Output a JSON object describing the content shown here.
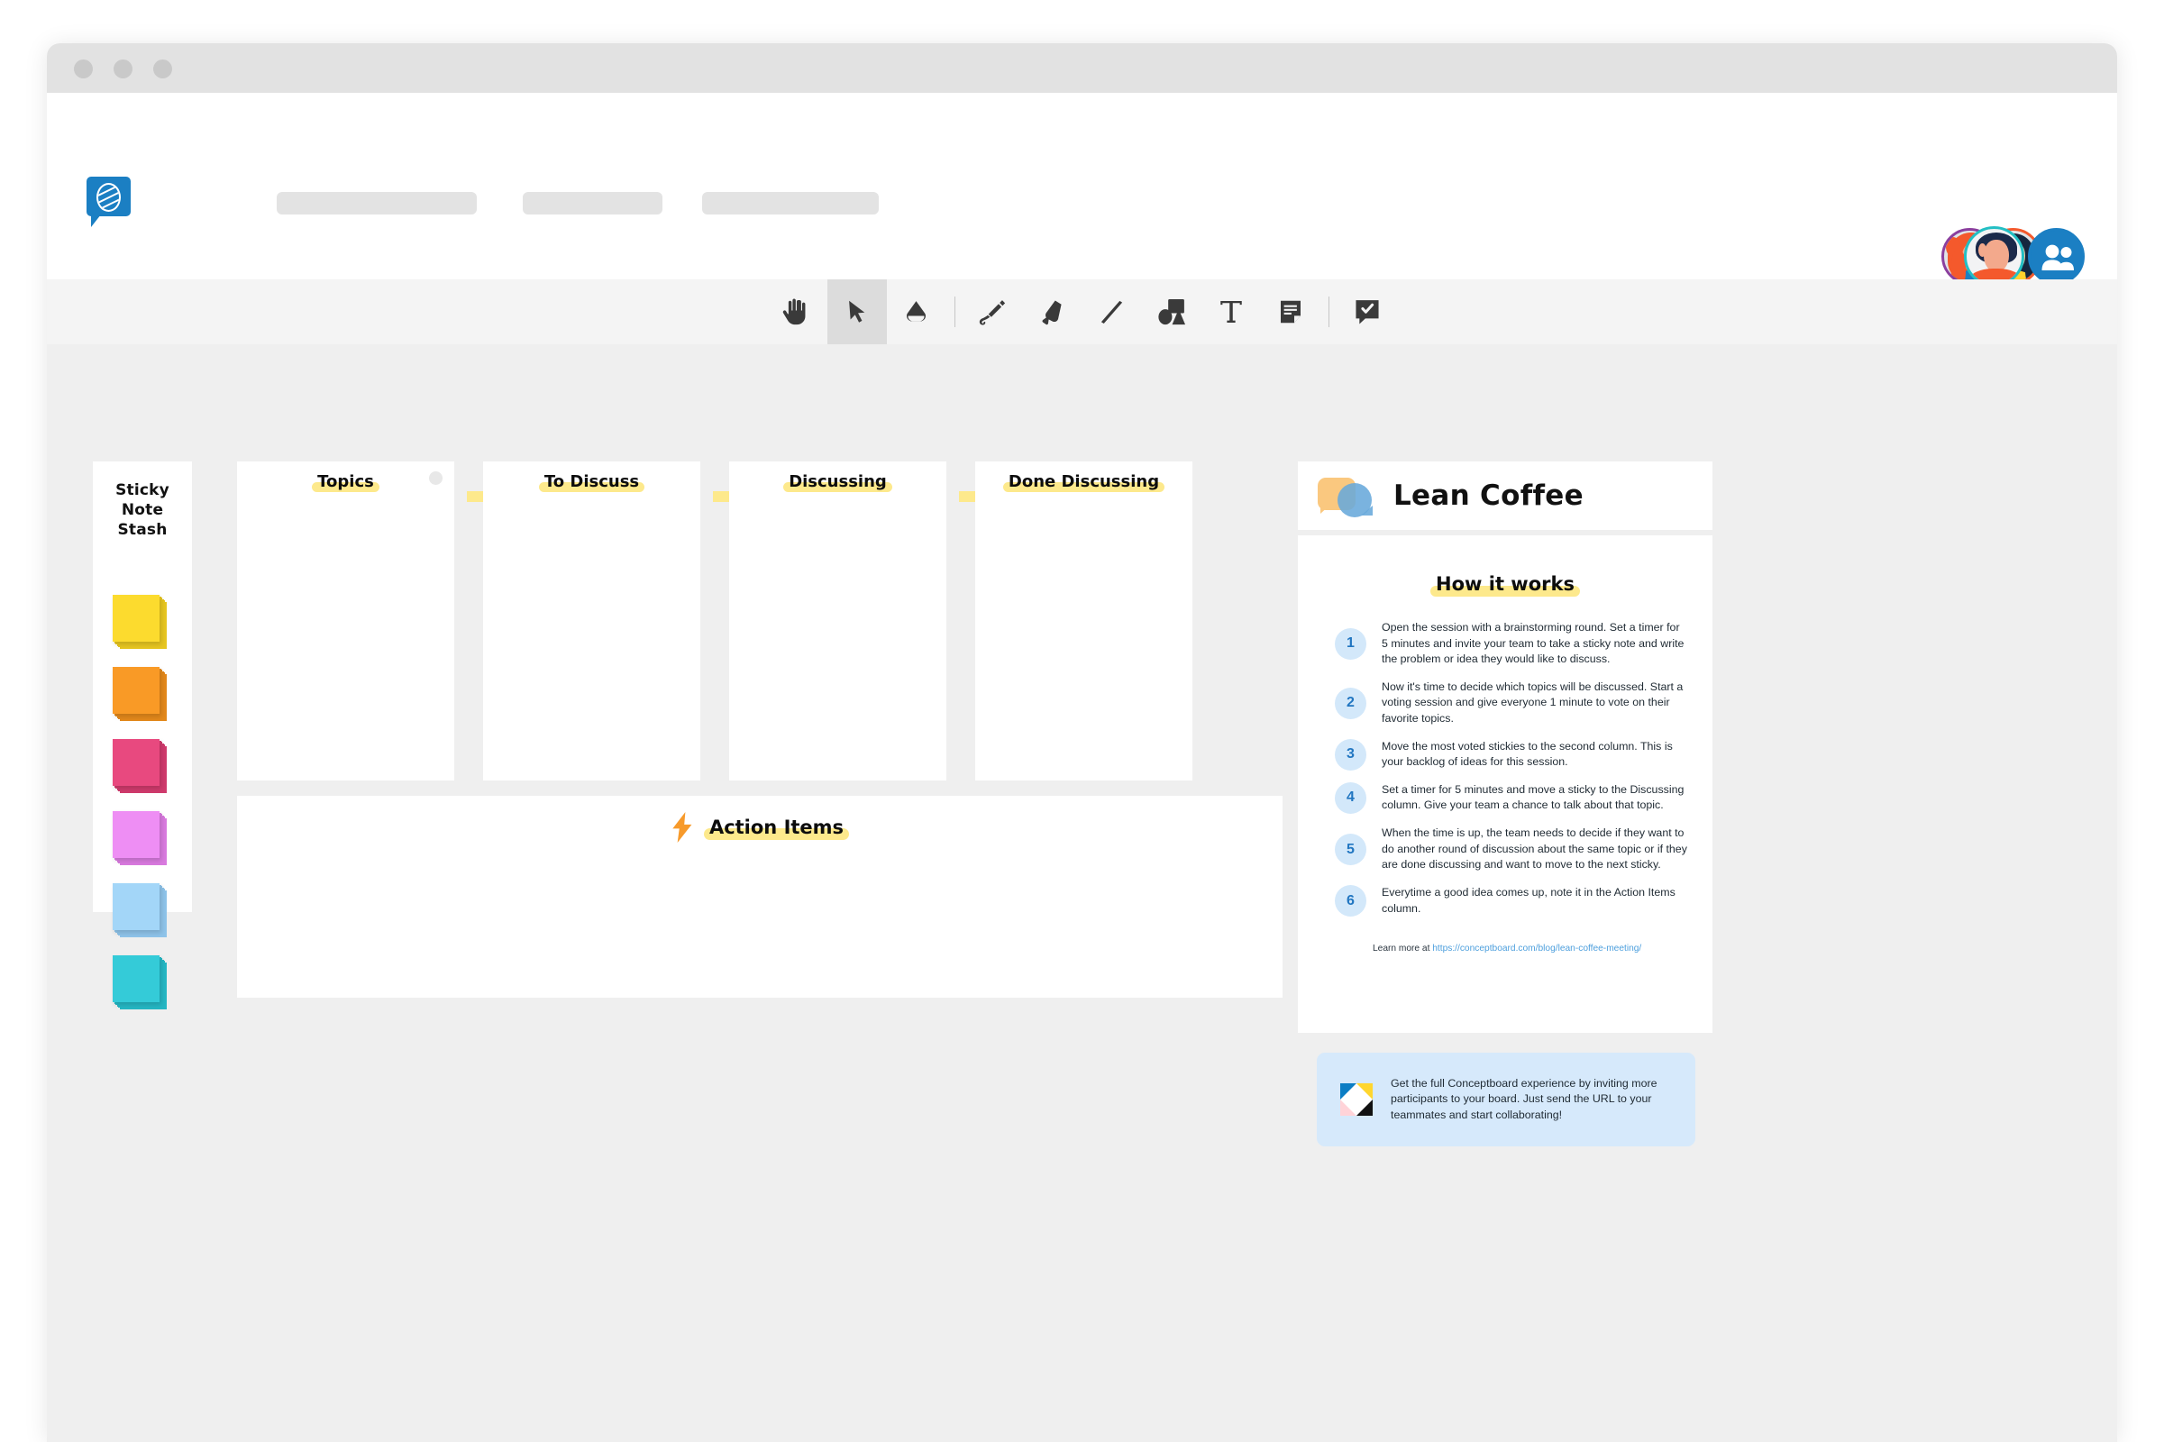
{
  "window": {
    "controls": [
      "close",
      "minimize",
      "maximize"
    ]
  },
  "header": {
    "logo_name": "conceptboard-logo",
    "nav_placeholders": [
      "",
      "",
      ""
    ],
    "avatars": [
      {
        "name": "collaborator-1",
        "ring": "#8b3f9e"
      },
      {
        "name": "collaborator-2",
        "ring": "#f4592c"
      },
      {
        "name": "invite-people",
        "ring": "#1b7fc3"
      }
    ],
    "self_avatar": {
      "name": "current-user",
      "ring": "#23bfc4"
    }
  },
  "toolbar": {
    "tools": [
      {
        "id": "hand",
        "label": "Pan",
        "active": false
      },
      {
        "id": "select",
        "label": "Select",
        "active": true
      },
      {
        "id": "eraser",
        "label": "Eraser",
        "active": false
      },
      {
        "id": "sep1",
        "label": "",
        "active": false
      },
      {
        "id": "pen",
        "label": "Pen",
        "active": false
      },
      {
        "id": "marker",
        "label": "Marker",
        "active": false
      },
      {
        "id": "line",
        "label": "Line",
        "active": false
      },
      {
        "id": "shapes",
        "label": "Shapes",
        "active": false
      },
      {
        "id": "text",
        "label": "Text",
        "active": false
      },
      {
        "id": "sticky-note",
        "label": "Sticky Note",
        "active": false
      },
      {
        "id": "sep2",
        "label": "",
        "active": false
      },
      {
        "id": "comment",
        "label": "Comment",
        "active": false
      }
    ]
  },
  "board": {
    "stash": {
      "title": "Sticky\nNote\nStash",
      "title_lines": [
        "Sticky",
        "Note",
        "Stash"
      ],
      "colors": [
        {
          "name": "yellow",
          "top": "#fcdb2e",
          "shade": "#e6c520"
        },
        {
          "name": "orange",
          "top": "#f99a26",
          "shade": "#e2881b"
        },
        {
          "name": "pink",
          "top": "#e8497f",
          "shade": "#cf3a6c"
        },
        {
          "name": "violet",
          "top": "#ee8ef4",
          "shade": "#d87ade"
        },
        {
          "name": "lightblue",
          "top": "#a3d6f8",
          "shade": "#8ec3e9"
        },
        {
          "name": "turquoise",
          "top": "#34cbd8",
          "shade": "#25b6c3"
        }
      ]
    },
    "columns": [
      {
        "id": "topics",
        "title": "Topics"
      },
      {
        "id": "to-discuss",
        "title": "To Discuss"
      },
      {
        "id": "discussing",
        "title": "Discussing"
      },
      {
        "id": "done-discussing",
        "title": "Done Discussing"
      }
    ],
    "action_items": {
      "title": "Action Items",
      "icon": "lightning-bolt-icon",
      "icon_color": "#f79a2b"
    }
  },
  "lean_coffee": {
    "title": "Lean Coffee",
    "icon": "speech-bubbles-icon",
    "how_it_works_title": "How it works",
    "steps": [
      {
        "num": "1",
        "text": "Open the session with a brainstorming round. Set a timer for 5 minutes and invite your team to take a sticky note and write the problem or idea they would like to discuss."
      },
      {
        "num": "2",
        "text": "Now it's time to decide which topics will be discussed. Start a voting session and give everyone 1 minute to vote on their favorite topics."
      },
      {
        "num": "3",
        "text": "Move the most voted stickies to the second column. This is your backlog of ideas for this session."
      },
      {
        "num": "4",
        "text": "Set a timer for 5 minutes and move a sticky to the Discussing column. Give your team a chance to talk about that topic."
      },
      {
        "num": "5",
        "text": "When the time is up, the team needs to decide if they want to do another round of discussion about the same topic or if they are done discussing and want to move to the next sticky."
      },
      {
        "num": "6",
        "text": "Everytime a good idea comes up, note it in the Action Items column."
      }
    ],
    "learn_more_prefix": "Learn more at ",
    "learn_more_link": "https://conceptboard.com/blog/lean-coffee-meeting/",
    "invite": {
      "icon": "conceptboard-mini-icon",
      "text": "Get the full Conceptboard experience by inviting more participants to your board. Just send the URL to your teammates and start collaborating!"
    }
  },
  "colors": {
    "highlight": "#fde98c",
    "brand_blue": "#1b7fc3",
    "canvas_bg": "#efefef",
    "toolbar_bg": "#f4f4f4",
    "step_badge_bg": "#d3e8fa",
    "step_badge_fg": "#2176c1",
    "invite_bg": "#d6e9fb",
    "link": "#4d9fdd"
  }
}
